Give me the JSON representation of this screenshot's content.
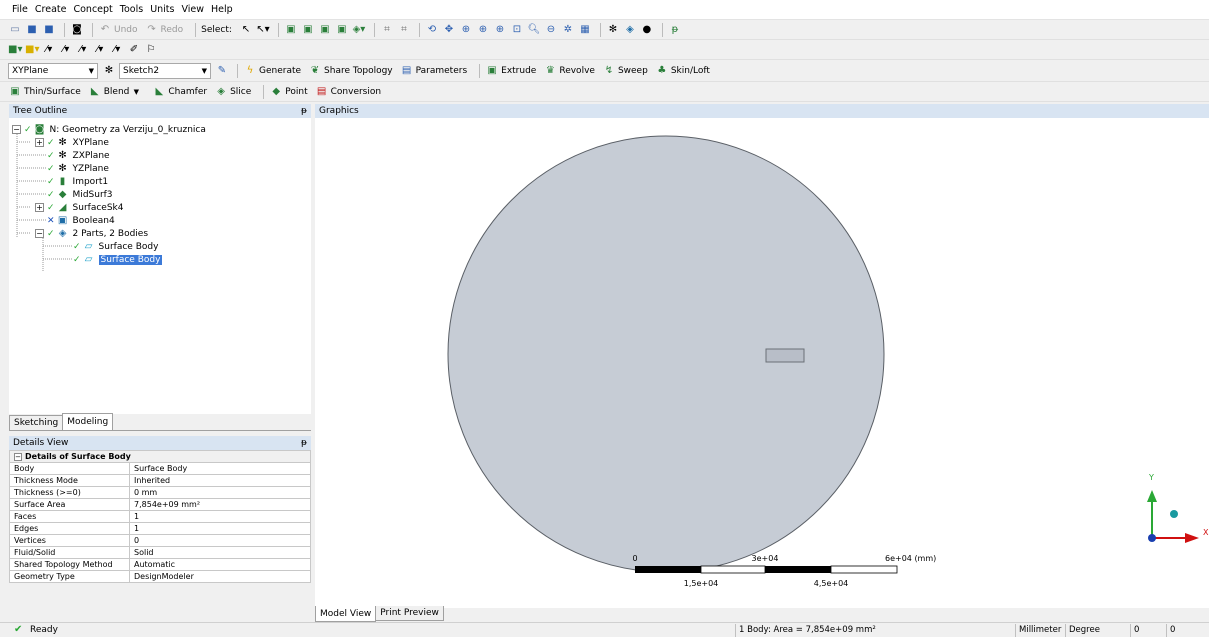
{
  "menu": [
    "File",
    "Create",
    "Concept",
    "Tools",
    "Units",
    "View",
    "Help"
  ],
  "toolbar1": {
    "undo_label": "Undo",
    "redo_label": "Redo",
    "select_label": "Select:"
  },
  "toolbar3": {
    "plane_combo": "XYPlane",
    "sketch_combo": "Sketch2",
    "generate_label": "Generate",
    "share_topology_label": "Share Topology",
    "parameters_label": "Parameters",
    "extrude_label": "Extrude",
    "revolve_label": "Revolve",
    "sweep_label": "Sweep",
    "skin_loft_label": "Skin/Loft"
  },
  "toolbar4": {
    "thin_surface_label": "Thin/Surface",
    "blend_label": "Blend",
    "chamfer_label": "Chamfer",
    "slice_label": "Slice",
    "point_label": "Point",
    "conversion_label": "Conversion"
  },
  "tree_outline": {
    "title": "Tree Outline",
    "pin": "ᵽ",
    "root": "N: Geometry za Verziju_0_kruznica",
    "items": [
      "XYPlane",
      "ZXPlane",
      "YZPlane",
      "Import1",
      "MidSurf3",
      "SurfaceSk4",
      "Boolean4",
      "2 Parts, 2 Bodies"
    ],
    "bodies": [
      "Surface Body",
      "Surface Body"
    ]
  },
  "tabs": [
    "Sketching",
    "Modeling"
  ],
  "details_view": {
    "title": "Details View",
    "pin": "ᵽ",
    "group": "Details of Surface Body",
    "rows": [
      {
        "key": "Body",
        "value": "Surface Body"
      },
      {
        "key": "Thickness Mode",
        "value": "Inherited"
      },
      {
        "key": "Thickness (>=0)",
        "value": "0 mm"
      },
      {
        "key": "Surface Area",
        "value": "7,854e+09 mm²"
      },
      {
        "key": "Faces",
        "value": "1"
      },
      {
        "key": "Edges",
        "value": "1"
      },
      {
        "key": "Vertices",
        "value": "0"
      },
      {
        "key": "Fluid/Solid",
        "value": "Solid"
      },
      {
        "key": "Shared Topology Method",
        "value": "Automatic"
      },
      {
        "key": "Geometry Type",
        "value": "DesignModeler"
      }
    ]
  },
  "graphics": {
    "title": "Graphics",
    "scale_labels_top": [
      "0",
      "3e+04",
      "6e+04 (mm)"
    ],
    "scale_labels_bottom": [
      "1,5e+04",
      "4,5e+04"
    ],
    "axis_y": "Y",
    "axis_x": "X"
  },
  "bottom_tabs": [
    "Model View",
    "Print Preview"
  ],
  "status": {
    "ready": "Ready",
    "selection": "1 Body: Area = 7,854e+09 mm²",
    "units": "Millimeter",
    "angle": "Degree",
    "v1": "0",
    "v2": "0"
  },
  "colors": {
    "disk": "#c6ccd5",
    "panel_title": "#d8e4f2",
    "selection": "#3c7ad8",
    "check": "#2aa835",
    "axis_y": "#2aa835",
    "axis_x": "#d01010",
    "axis_z": "#1a9aa0"
  }
}
